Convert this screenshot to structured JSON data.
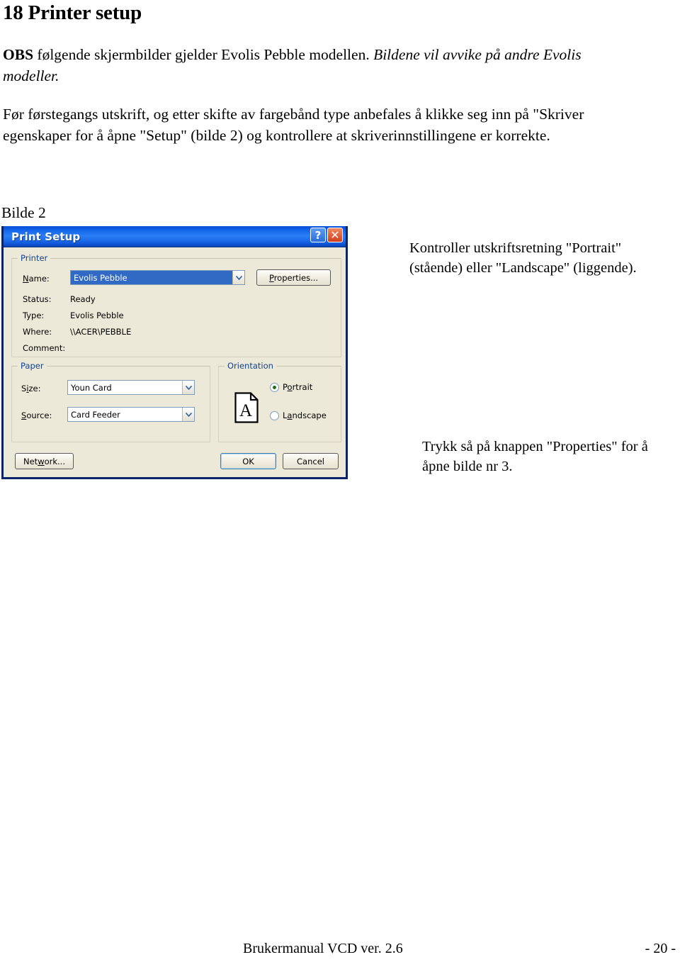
{
  "document": {
    "title": "18 Printer setup",
    "paragraphs": {
      "obs_bold": "OBS",
      "obs_rest": " følgende skjermbilder gjelder Evolis Pebble modellen. ",
      "obs_italic": "Bildene vil avvike på andre Evolis modeller.",
      "intro": "Før førstegangs utskrift, og etter skifte av fargebånd type anbefales å klikke seg inn på \"Skriver egenskaper for å åpne \"Setup\" (bilde 2) og kontrollere at skriverinnstillingene er korrekte."
    },
    "figure_caption": "Bilde 2",
    "annotations": {
      "orientation_note": "Kontroller utskriftsretning \"Portrait\" (stående) eller \"Landscape\" (liggende).",
      "properties_note": "Trykk så på knappen \"Properties\" for å åpne bilde nr 3."
    },
    "footer": {
      "left": "Brukermanual VCD ver. 2.6",
      "right": "- 20 -"
    }
  },
  "dialog": {
    "title": "Print Setup",
    "titlebar_buttons": {
      "help": "?",
      "close": "✕"
    },
    "printer_group": {
      "legend": "Printer",
      "name_label": "Name:",
      "name_value": "Evolis Pebble",
      "properties_button": "Properties...",
      "status_label": "Status:",
      "status_value": "Ready",
      "type_label": "Type:",
      "type_value": "Evolis Pebble",
      "where_label": "Where:",
      "where_value": "\\\\ACER\\PEBBLE",
      "comment_label": "Comment:",
      "comment_value": ""
    },
    "paper_group": {
      "legend": "Paper",
      "size_label": "Size:",
      "size_value": "Youn Card",
      "source_label": "Source:",
      "source_value": "Card Feeder"
    },
    "orientation_group": {
      "legend": "Orientation",
      "portrait_label": "Portrait",
      "landscape_label": "Landscape",
      "selected": "Portrait",
      "preview_letter": "A"
    },
    "buttons": {
      "network": "Network...",
      "ok": "OK",
      "cancel": "Cancel"
    },
    "colors": {
      "titlebar_blue": "#0a53d6",
      "dialog_face": "#ece9d8",
      "border_blue": "#0a246a",
      "selection_blue": "#316ac5",
      "group_label": "#15428b",
      "radio_dot_green": "#1d6f1d",
      "close_red": "#d23b1c"
    }
  }
}
